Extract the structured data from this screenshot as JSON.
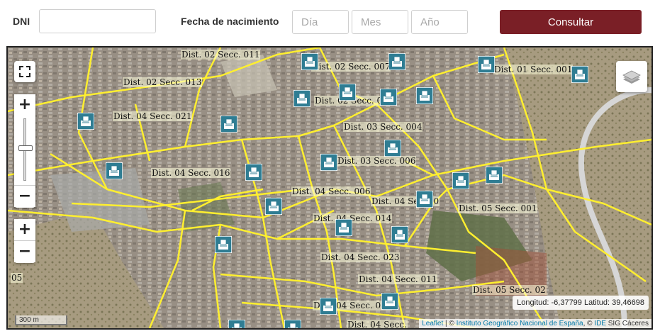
{
  "form": {
    "dni_label": "DNI",
    "dni_value": "",
    "birth_label": "Fecha de nacimiento",
    "day_placeholder": "Día",
    "month_placeholder": "Mes",
    "year_placeholder": "Año",
    "submit_label": "Consultar",
    "accent_color": "#7a1f26"
  },
  "map": {
    "controls": {
      "fullscreen_icon": "fullscreen-icon",
      "zoom_in": "+",
      "zoom_out": "−",
      "layers_icon": "layers-icon"
    },
    "section_labels": [
      "Dist. 02 Secc. 011",
      "Dist. 02 Secc. 007",
      "Dist. 01 Secc. 001",
      "Dist. 02 Secc. 013",
      "Dist. 02 Secc. 0",
      "Dist. 04 Secc. 021",
      "Dist. 03 Secc. 004",
      "Dist. 03 Secc. 006",
      "Dist. 04 Secc. 016",
      "Dist. 04 Secc. 006",
      "Dist. 04 Secc. 0",
      "Dist. 05 Secc. 001",
      "Dist. 04 Secc. 014",
      "Dist. 04 Secc. 023",
      "Dist. 04 Secc. 011",
      "Dist. 05 Secc. 02",
      "Dist. 04 Secc. 018",
      "Dist. 04 Secc.",
      "05"
    ],
    "coordinates": "Longitud: -6,37799 Latitud: 39,46698",
    "scale": "300 m",
    "attribution": {
      "leaflet": "Leaflet",
      "sep": " | © ",
      "ign": "Instituto Geográfico Nacional de España",
      "mid": ", © ",
      "ide": "IDE",
      "tail": " SIG Cáceres"
    }
  }
}
